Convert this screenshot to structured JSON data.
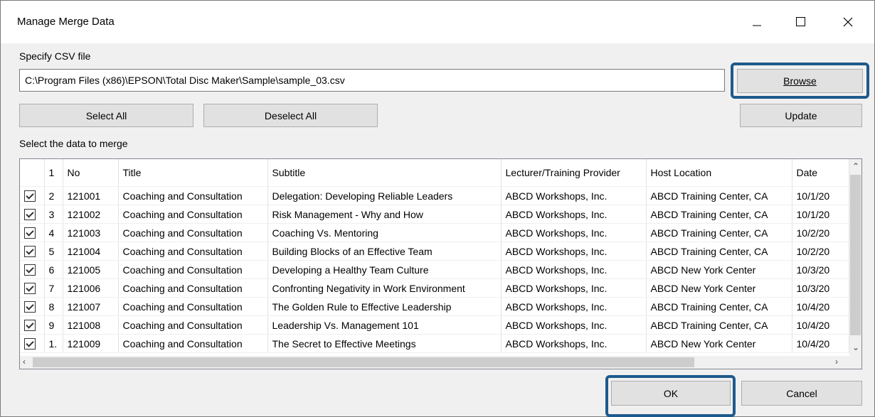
{
  "window": {
    "title": "Manage Merge Data",
    "controls": [
      "minimize-icon",
      "maximize-icon",
      "close-icon"
    ]
  },
  "csv": {
    "label": "Specify CSV file",
    "path": "C:\\Program Files (x86)\\EPSON\\Total Disc Maker\\Sample\\sample_03.csv",
    "browse_label": "Browse"
  },
  "toolbar": {
    "select_all": "Select All",
    "deselect_all": "Deselect All",
    "update": "Update"
  },
  "merge_label": "Select the data to merge",
  "table": {
    "columns": [
      "1",
      "No",
      "Title",
      "Subtitle",
      "Lecturer/Training Provider",
      "Host Location",
      "Date"
    ],
    "rows": [
      {
        "checked": true,
        "idx": "2",
        "no": "121001",
        "title": "Coaching and Consultation",
        "subtitle": "Delegation: Developing Reliable Leaders",
        "lecturer": "ABCD Workshops, Inc.",
        "host": "ABCD Training Center, CA",
        "date": "10/1/20"
      },
      {
        "checked": true,
        "idx": "3",
        "no": "121002",
        "title": "Coaching and Consultation",
        "subtitle": "Risk Management - Why and How",
        "lecturer": "ABCD Workshops, Inc.",
        "host": "ABCD Training Center, CA",
        "date": "10/1/20"
      },
      {
        "checked": true,
        "idx": "4",
        "no": "121003",
        "title": "Coaching and Consultation",
        "subtitle": "Coaching Vs. Mentoring",
        "lecturer": "ABCD Workshops, Inc.",
        "host": "ABCD Training Center, CA",
        "date": "10/2/20"
      },
      {
        "checked": true,
        "idx": "5",
        "no": "121004",
        "title": "Coaching and Consultation",
        "subtitle": "Building Blocks of an Effective Team",
        "lecturer": "ABCD Workshops, Inc.",
        "host": "ABCD Training Center, CA",
        "date": "10/2/20"
      },
      {
        "checked": true,
        "idx": "6",
        "no": "121005",
        "title": "Coaching and Consultation",
        "subtitle": "Developing a Healthy Team Culture",
        "lecturer": "ABCD Workshops, Inc.",
        "host": "ABCD New York Center",
        "date": "10/3/20"
      },
      {
        "checked": true,
        "idx": "7",
        "no": "121006",
        "title": "Coaching and Consultation",
        "subtitle": "Confronting Negativity in Work Environment",
        "lecturer": "ABCD Workshops, Inc.",
        "host": "ABCD New York Center",
        "date": "10/3/20"
      },
      {
        "checked": true,
        "idx": "8",
        "no": "121007",
        "title": "Coaching and Consultation",
        "subtitle": "The Golden Rule to Effective Leadership",
        "lecturer": "ABCD Workshops, Inc.",
        "host": "ABCD Training Center, CA",
        "date": "10/4/20"
      },
      {
        "checked": true,
        "idx": "9",
        "no": "121008",
        "title": "Coaching and Consultation",
        "subtitle": "Leadership Vs. Management 101",
        "lecturer": "ABCD Workshops, Inc.",
        "host": "ABCD Training Center, CA",
        "date": "10/4/20"
      },
      {
        "checked": true,
        "idx": "1.",
        "no": "121009",
        "title": "Coaching and Consultation",
        "subtitle": "The Secret to Effective Meetings",
        "lecturer": "ABCD Workshops, Inc.",
        "host": "ABCD New York Center",
        "date": "10/4/20"
      }
    ]
  },
  "footer": {
    "ok": "OK",
    "cancel": "Cancel"
  },
  "colors": {
    "highlight": "#1e5a8c",
    "button_bg": "#e1e1e1"
  }
}
